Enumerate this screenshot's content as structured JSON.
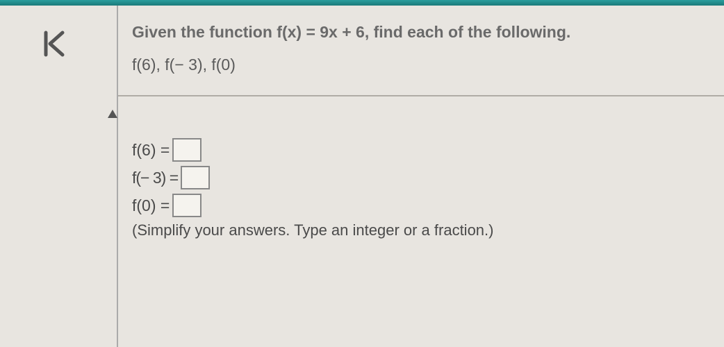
{
  "question": {
    "prompt": "Given the function f(x) = 9x + 6, find each of the following.",
    "sublist": "f(6), f(− 3), f(0)"
  },
  "answers": {
    "rows": [
      {
        "label": "f(6) ="
      },
      {
        "label": "f(− 3) ="
      },
      {
        "label": "f(0) ="
      }
    ],
    "instruction": "(Simplify your answers. Type an integer or a fraction.)"
  }
}
